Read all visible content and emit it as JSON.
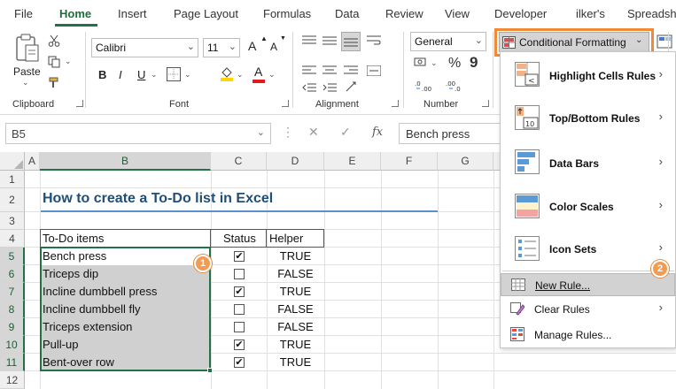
{
  "tabs": [
    "File",
    "Home",
    "Insert",
    "Page Layout",
    "Formulas",
    "Data",
    "Review",
    "View",
    "Developer",
    "ilker's",
    "Spreadsh"
  ],
  "ribbon": {
    "clipboard": {
      "paste_label": "Paste",
      "group_label": "Clipboard"
    },
    "font": {
      "font_name": "Calibri",
      "font_size": "11",
      "bold": "B",
      "italic": "I",
      "underline": "U",
      "grow": "A",
      "shrink": "A",
      "font_color": "A",
      "group_label": "Font"
    },
    "alignment": {
      "group_label": "Alignment"
    },
    "number": {
      "format": "General",
      "group_label": "Number",
      "currency": "$",
      "percent": "%",
      "comma": "9"
    },
    "conditional_formatting_label": "Conditional Formatting"
  },
  "formula_bar": {
    "name_box": "B5",
    "fx": "fx",
    "content": "Bench press"
  },
  "columns": [
    "A",
    "B",
    "C",
    "D",
    "E",
    "F",
    "G"
  ],
  "rows": [
    "1",
    "2",
    "3",
    "4",
    "5",
    "6",
    "7",
    "8",
    "9",
    "10",
    "11",
    "12"
  ],
  "sheet": {
    "title": "How to create a To-Do list in Excel",
    "headers": {
      "items": "To-Do items",
      "status": "Status",
      "helper": "Helper"
    },
    "tasks": [
      {
        "item": "Bench press",
        "checked": true,
        "helper": "TRUE"
      },
      {
        "item": "Triceps dip",
        "checked": false,
        "helper": "FALSE"
      },
      {
        "item": "Incline dumbbell press",
        "checked": true,
        "helper": "TRUE"
      },
      {
        "item": "Incline dumbbell fly",
        "checked": false,
        "helper": "FALSE"
      },
      {
        "item": "Triceps extension",
        "checked": false,
        "helper": "FALSE"
      },
      {
        "item": "Pull-up",
        "checked": true,
        "helper": "TRUE"
      },
      {
        "item": "Bent-over row",
        "checked": true,
        "helper": "TRUE"
      }
    ]
  },
  "badges": {
    "one": "1",
    "two": "2"
  },
  "menu": {
    "items": [
      {
        "label": "Highlight Cells Rules",
        "icon": "highlight-cells-icon",
        "submenu": true
      },
      {
        "label": "Top/Bottom Rules",
        "icon": "top-bottom-icon",
        "submenu": true
      },
      {
        "label": "Data Bars",
        "icon": "data-bars-icon",
        "submenu": true
      },
      {
        "label": "Color Scales",
        "icon": "color-scales-icon",
        "submenu": true
      },
      {
        "label": "Icon Sets",
        "icon": "icon-sets-icon",
        "submenu": true
      }
    ],
    "new_rule": "New Rule...",
    "clear_rules": "Clear Rules",
    "manage_rules": "Manage Rules..."
  },
  "colors": {
    "accent": "#217346",
    "highlight_orange": "#f08a37",
    "title_blue": "#1f4e79",
    "selection_gray": "#d0d0d0"
  }
}
